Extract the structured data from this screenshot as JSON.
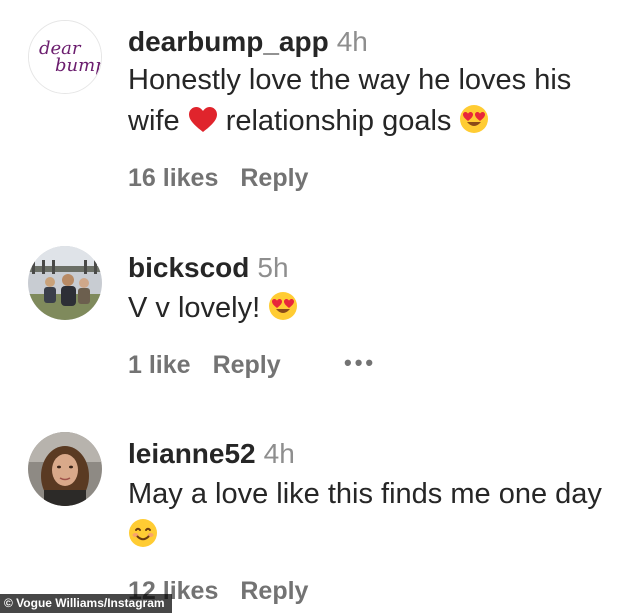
{
  "comments": [
    {
      "username": "dearbump_app",
      "time": "4h",
      "text_before": "Honestly love the way he loves his wife",
      "text_middle": "relationship goals",
      "likes": "16 likes",
      "reply": "Reply",
      "avatar_logo_line1": "dear",
      "avatar_logo_line2": "bump"
    },
    {
      "username": "bickscod",
      "time": "5h",
      "text": "V v lovely!",
      "likes": "1 like",
      "reply": "Reply",
      "more": "•••"
    },
    {
      "username": "leianne52",
      "time": "4h",
      "text": "May a love like this finds me one day",
      "likes": "12 likes",
      "reply": "Reply"
    }
  ],
  "credit": "© Vogue Williams/Instagram",
  "icons": {
    "heart": "red-heart-emoji",
    "heart_eyes": "heart-eyes-emoji",
    "smile": "smiling-face-emoji"
  },
  "colors": {
    "username": "#262626",
    "secondary": "#8e8e8e",
    "meta": "#737373",
    "logo": "#6b1d6e"
  }
}
